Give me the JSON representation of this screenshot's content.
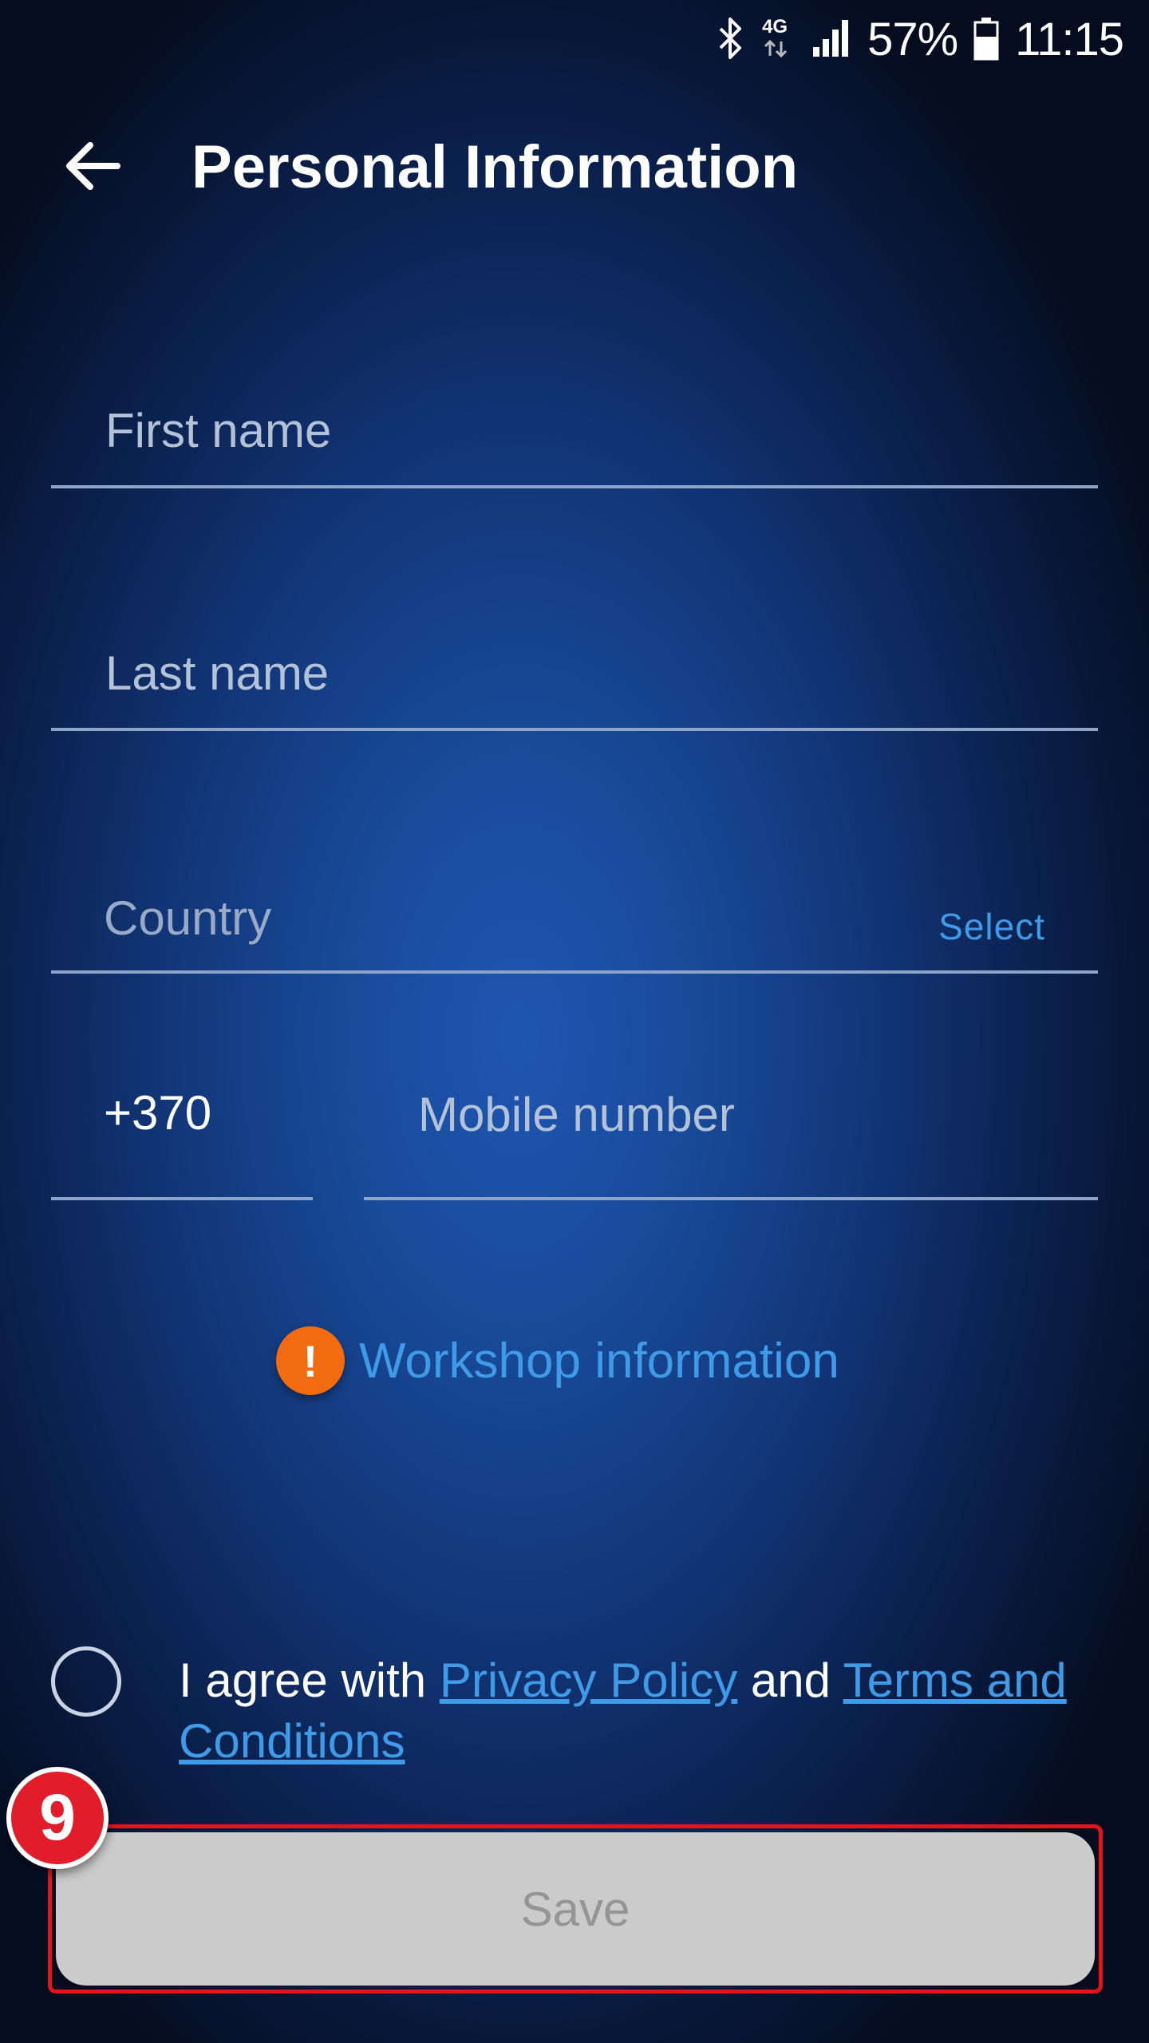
{
  "status_bar": {
    "network": "4G",
    "battery": "57%",
    "time": "11:15"
  },
  "header": {
    "title": "Personal Information"
  },
  "form": {
    "first_name_placeholder": "First name",
    "last_name_placeholder": "Last name",
    "country_label": "Country",
    "country_action": "Select",
    "phone_prefix": "+370",
    "mobile_placeholder": "Mobile number"
  },
  "workshop": {
    "alert_symbol": "!",
    "label": "Workshop information"
  },
  "agreement": {
    "prefix": "I agree with ",
    "privacy_link": "Privacy Policy",
    "middle": " and ",
    "terms_link": "Terms and Conditions",
    "checked": false
  },
  "save": {
    "label": "Save"
  },
  "annotation": {
    "step_number": "9",
    "highlight_color": "#e4141b"
  },
  "colors": {
    "accent": "#3f9ae8",
    "alert": "#f26b0f"
  }
}
